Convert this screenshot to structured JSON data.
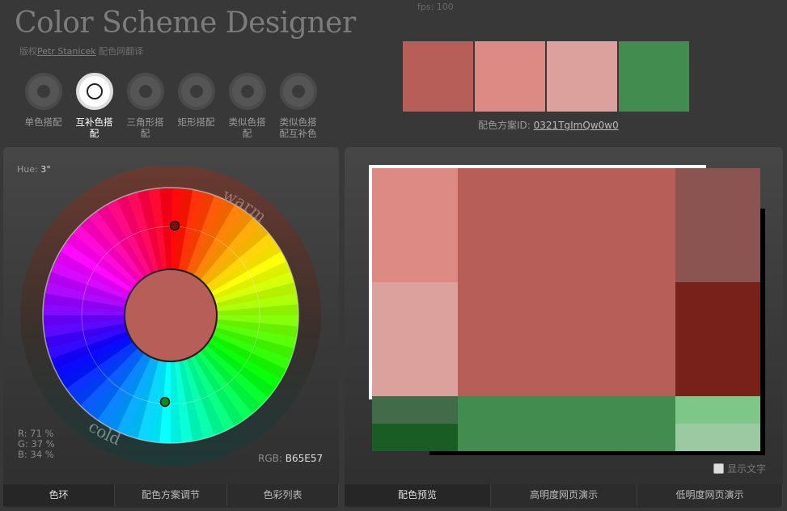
{
  "fps": "fps: 100",
  "header": {
    "title": "Color Scheme Designer",
    "credit_prefix": "版权",
    "credit_author": "Petr Stanicek",
    "credit_suffix": "配色网翻译"
  },
  "modes": [
    {
      "label": "单色搭配",
      "icon": "mono-scheme-icon",
      "active": false
    },
    {
      "label": "互补色搭配",
      "icon": "complement-scheme-icon",
      "active": true
    },
    {
      "label": "三角形搭配",
      "icon": "triad-scheme-icon",
      "active": false
    },
    {
      "label": "矩形搭配",
      "icon": "tetrad-scheme-icon",
      "active": false
    },
    {
      "label": "类似色搭配",
      "icon": "analogic-scheme-icon",
      "active": false
    },
    {
      "label": "类似色搭配互补色",
      "icon": "accented-analogic-scheme-icon",
      "active": false
    }
  ],
  "palette": {
    "swatches": [
      "#B65E57",
      "#DD8A84",
      "#DCA19D",
      "#438C4F"
    ],
    "id_label": "配色方案ID:",
    "id_value": "0321TgImQw0w0"
  },
  "wheel_panel": {
    "hue_label": "Hue:",
    "hue_value": "3°",
    "warm_label": "warm",
    "cold_label": "cold",
    "r": "R: 71 %",
    "g": "G: 37 %",
    "b": "B: 34 %",
    "rgb_label": "RGB:",
    "rgb_value": "B65E57",
    "center_color": "#B65E57"
  },
  "preview_colors": {
    "main": "#B65E57",
    "light1": "#DD8A84",
    "light2": "#DCA19D",
    "dark1": "#8B5450",
    "dark2": "#78211A",
    "comp_main": "#438C4F",
    "comp_dark1": "#426B49",
    "comp_dark2": "#195C24",
    "comp_light1": "#7DC889",
    "comp_light2": "#9AC9A2"
  },
  "show_text_label": "显示文字",
  "left_tabs": [
    "色环",
    "配色方案调节",
    "色彩列表"
  ],
  "right_tabs": [
    "配色预览",
    "高明度网页演示",
    "低明度网页演示"
  ]
}
